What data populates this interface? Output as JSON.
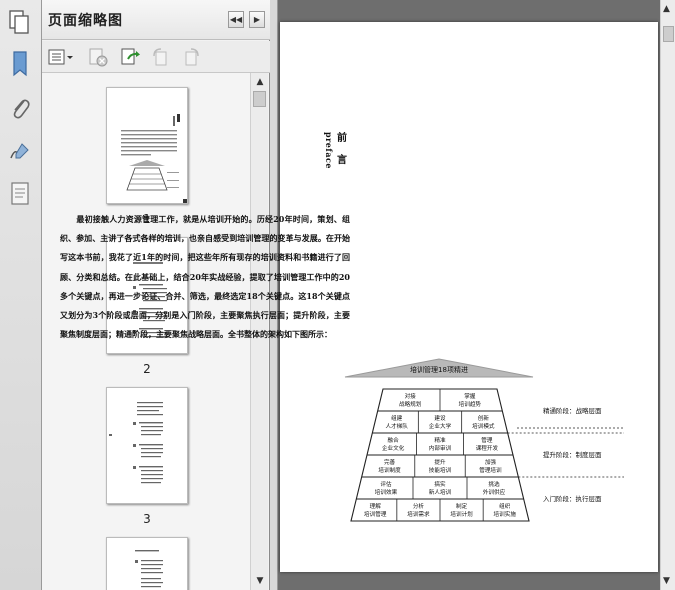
{
  "panel": {
    "title": "页面缩略图",
    "collapse_hint": "◀◀",
    "next_hint": "▶"
  },
  "rail": {
    "icons": [
      "pages-icon",
      "bookmarks-icon",
      "attachments-icon",
      "signatures-icon",
      "layers-icon"
    ]
  },
  "toolbar": {
    "icons": [
      "options-icon",
      "delete-page-icon",
      "extract-page-icon",
      "rotate-ccw-icon",
      "rotate-cw-icon"
    ]
  },
  "thumbnails": [
    {
      "label": "1"
    },
    {
      "label": "2"
    },
    {
      "label": "3"
    },
    {
      "label": ""
    }
  ],
  "page": {
    "heading_cn_1": "前",
    "heading_cn_2": "言",
    "heading_en": "preface",
    "paragraph": "　　最初接触人力资源管理工作，就是从培训开始的。历经20年时间，策划、组织、参加、主讲了各式各样的培训，也亲自感受到培训管理的变革与发展。在开始写这本书前，我花了近1年的时间，把这些年所有现存的培训资料和书籍进行了回顾、分类和总结。在此基础上，结合20年实战经验，提取了培训管理工作中的20多个关键点，再进一步论证、合并、筛选，最终选定18个关键点。这18个关键点又划分为3个阶段或层面，分别是入门阶段，主要聚焦执行层面；提升阶段，主要聚焦制度层面；精通阶段，主要聚焦战略层面。全书整体的架构如下图所示："
  },
  "diagram": {
    "roof_label": "培训管理18项精进",
    "rows": [
      [
        "对接\n战略规划",
        "掌握\n培训趋势"
      ],
      [
        "组建\n人才梯队",
        "建设\n企业大学",
        "创新\n培训模式"
      ],
      [
        "融合\n企业文化",
        "精准\n内部审训",
        "管理\n课程开发"
      ],
      [
        "完善\n培训制度",
        "提升\n技能培训",
        "加强\n管理培训"
      ],
      [
        "评估\n培训效果",
        "搞实\n新人培训",
        "挑选\n外训供应"
      ],
      [
        "理解\n培训管理",
        "分析\n培训需求",
        "制定\n培训计划",
        "组织\n培训实施"
      ]
    ],
    "stages": [
      "精通阶段：战略层面",
      "提升阶段：制度层面",
      "入门阶段：执行层面"
    ]
  }
}
